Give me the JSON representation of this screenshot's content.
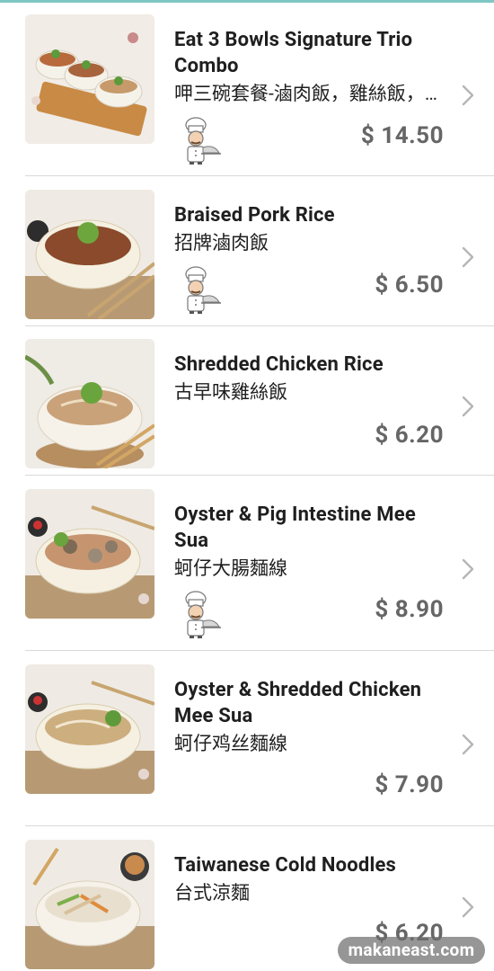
{
  "currency_symbol": "$",
  "items": [
    {
      "name_en": "Eat 3 Bowls Signature Trio Combo",
      "name_zh": "呷三碗套餐-滷肉飯，雞絲飯，大腸麵線",
      "price": "$ 14.50",
      "chef_badge": true
    },
    {
      "name_en": "Braised Pork Rice",
      "name_zh": "招牌滷肉飯",
      "price": "$ 6.50",
      "chef_badge": true
    },
    {
      "name_en": "Shredded Chicken Rice",
      "name_zh": "古早味雞絲飯",
      "price": "$ 6.20",
      "chef_badge": false
    },
    {
      "name_en": "Oyster & Pig Intestine Mee Sua",
      "name_zh": "蚵仔大腸麵線",
      "price": "$ 8.90",
      "chef_badge": true
    },
    {
      "name_en": "Oyster & Shredded Chicken Mee Sua",
      "name_zh": "蚵仔鸡丝麵線",
      "price": "$ 7.90",
      "chef_badge": false
    },
    {
      "name_en": "Taiwanese Cold Noodles",
      "name_zh": "台式涼麵",
      "price": "$ 6.20",
      "chef_badge": false
    }
  ],
  "watermark": "makaneast.com",
  "icons": {
    "chevron": "chevron-right-icon",
    "chef": "chef-icon"
  },
  "colors": {
    "accent": "#7fc7c3",
    "price": "#666666",
    "chevron": "#b5b5b5"
  }
}
